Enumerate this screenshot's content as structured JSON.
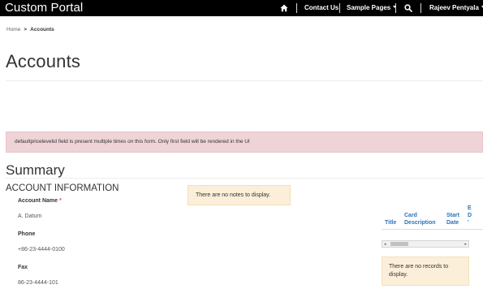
{
  "navbar": {
    "brand": "Custom Portal",
    "contact": "Contact Us",
    "sample_pages": "Sample Pages",
    "user": "Rajeev Pentyala",
    "icons": [
      "home-icon",
      "search-icon"
    ]
  },
  "breadcrumb": {
    "home": "Home",
    "separator": ">",
    "current": "Accounts"
  },
  "page": {
    "title": "Accounts"
  },
  "alert": {
    "text": "defaultpricelevelid field is present multiple times on this form. Only first field will be rendered in the UI"
  },
  "summary": {
    "title": "Summary",
    "section": "ACCOUNT INFORMATION",
    "fields": [
      {
        "label": "Account Name",
        "required": "*",
        "value": "A. Datum"
      },
      {
        "label": "Phone",
        "value": "+86-23-4444-0100"
      },
      {
        "label": "Fax",
        "value": "86-23-4444-101"
      }
    ]
  },
  "notes": {
    "empty": "There are no notes to display."
  },
  "grid": {
    "columns": {
      "title": "Title",
      "card_line1": "Card",
      "card_line2": "Description",
      "start_line1": "Start",
      "start_line2": "Date",
      "end_line1": "E",
      "end_line2": "D",
      "end_line3": "'"
    },
    "scroll_left": "◂",
    "scroll_right": "▸",
    "empty": "There are no records to display."
  },
  "colors": {
    "navbar": "#000000",
    "alert_bg": "#eed3d7",
    "info_bg": "#fcefd9",
    "link": "#2c72b8",
    "required": "#d9534f"
  }
}
